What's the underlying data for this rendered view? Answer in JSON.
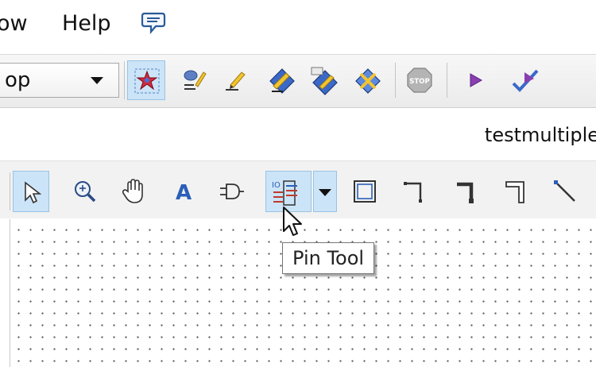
{
  "menubar": {
    "items": [
      {
        "label": "ow"
      },
      {
        "label": "Help"
      }
    ],
    "chat_icon": "speech-bubble-icon"
  },
  "toolbar1": {
    "combo_value": "op",
    "buttons": [
      {
        "icon": "selection-star-icon",
        "pressed": true
      },
      {
        "icon": "shovel-pencil-icon"
      },
      {
        "icon": "pencil-icon"
      },
      {
        "icon": "blue-diamond-pencil-icon"
      },
      {
        "icon": "blue-diamond-tag-icon"
      },
      {
        "icon": "blue-diamond-cross-icon"
      },
      {
        "icon": "stop-icon"
      },
      {
        "icon": "play-icon"
      },
      {
        "icon": "run-check-icon"
      }
    ],
    "stop_text": "STOP"
  },
  "file": {
    "name": "testmultiple"
  },
  "toolbar2": {
    "tools": [
      {
        "icon": "arrow-pointer-icon",
        "pressed": true
      },
      {
        "icon": "zoom-icon"
      },
      {
        "icon": "hand-pan-icon"
      },
      {
        "icon": "text-icon",
        "glyph": "A"
      },
      {
        "icon": "gate-icon"
      },
      {
        "icon": "pin-tool-icon",
        "pressed": true
      },
      {
        "icon": "rectangle-icon"
      },
      {
        "icon": "wire-corner-icon"
      },
      {
        "icon": "thick-wire-corner-icon"
      },
      {
        "icon": "bus-corner-icon"
      },
      {
        "icon": "diagonal-line-icon"
      }
    ]
  },
  "tooltip": {
    "text": "Pin Tool"
  },
  "colors": {
    "pressed_bg": "#cce4f7",
    "pressed_border": "#98c3e4",
    "canvas_dot": "#555555"
  }
}
